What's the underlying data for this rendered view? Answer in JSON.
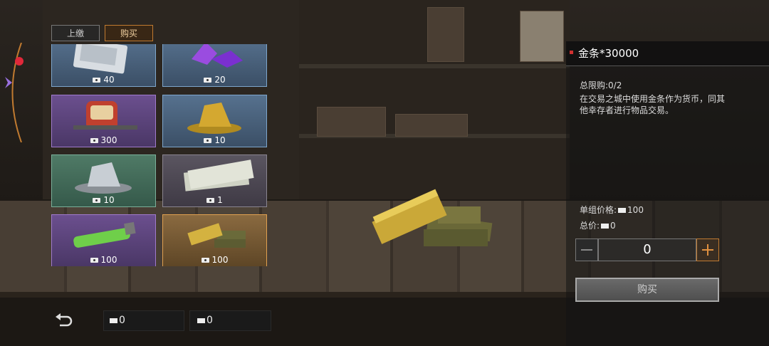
{
  "tabs": [
    {
      "label": "上缴"
    },
    {
      "label": "购买"
    }
  ],
  "items": [
    {
      "name": "map",
      "price": "40",
      "currency": "cash-icon"
    },
    {
      "name": "crystal",
      "price": "20",
      "currency": "cash-icon"
    },
    {
      "name": "backpack",
      "price": "300",
      "currency": "cash-icon"
    },
    {
      "name": "gold-ore",
      "price": "10",
      "currency": "cash-icon"
    },
    {
      "name": "silver-ore",
      "price": "10",
      "currency": "cash-icon"
    },
    {
      "name": "banknotes",
      "price": "1",
      "currency": "cash-icon"
    },
    {
      "name": "serum",
      "price": "100",
      "currency": "ticket-icon"
    },
    {
      "name": "gold-bars",
      "price": "100",
      "currency": "ticket-icon"
    }
  ],
  "detail": {
    "title": "金条*30000",
    "limit": "总限购:0/2",
    "description": "在交易之城中使用金条作为货币，同其他幸存者进行物品交易。",
    "unit_price_label": "单组价格:",
    "unit_price": "100",
    "total_label": "总价:",
    "total": "0",
    "quantity": "0",
    "buy_label": "购买"
  },
  "footer": {
    "cash_balance": "0",
    "ticket_balance": "0"
  },
  "colors": {
    "selected_border": "#e0a050",
    "buy_button": "#5a5a5a"
  }
}
